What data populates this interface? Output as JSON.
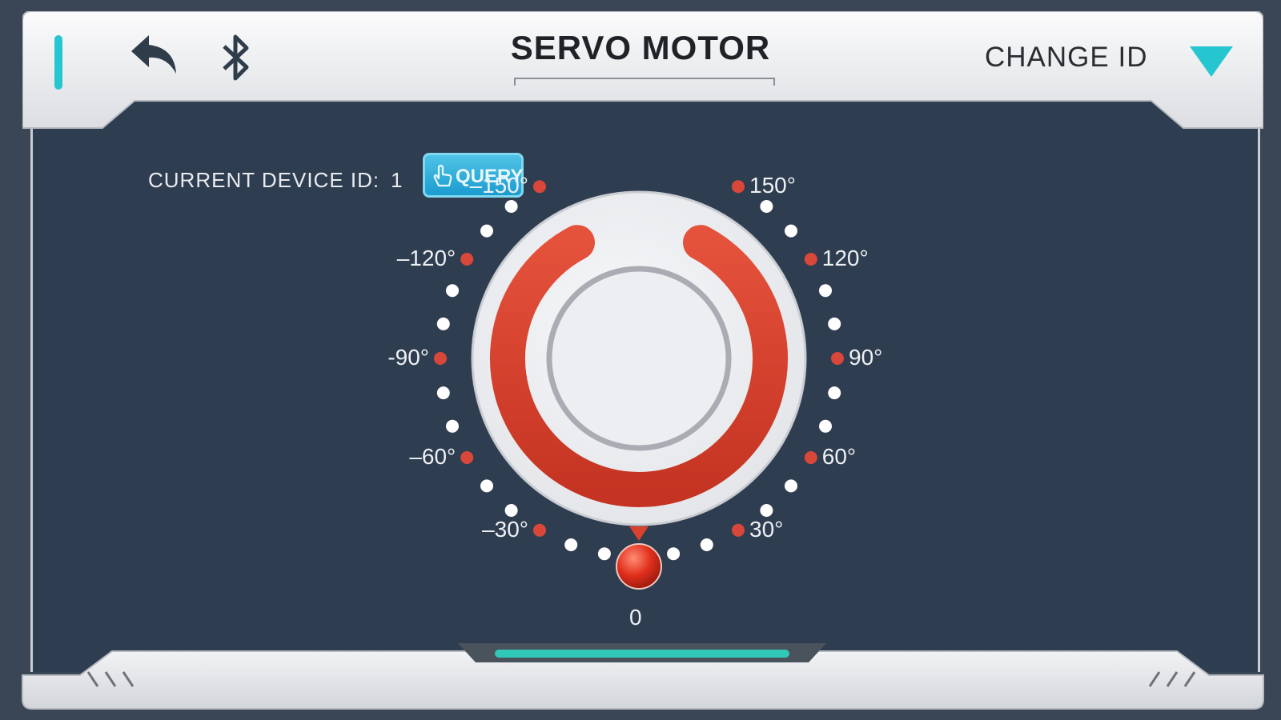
{
  "header": {
    "title": "SERVO MOTOR",
    "change_id_label": "CHANGE ID",
    "icons": [
      "accent-bar",
      "back-arrow-icon",
      "bluetooth-icon",
      "dropdown-triangle-icon"
    ]
  },
  "device": {
    "label": "CURRENT DEVICE ID:",
    "id_value": "1",
    "query_label": "QUERY"
  },
  "dial": {
    "current_angle": 0,
    "current_angle_label": "0",
    "labels": [
      {
        "angle": 150,
        "text": "150°"
      },
      {
        "angle": 120,
        "text": "120°"
      },
      {
        "angle": 90,
        "text": "90°"
      },
      {
        "angle": 60,
        "text": "60°"
      },
      {
        "angle": 30,
        "text": "30°"
      },
      {
        "angle": -30,
        "text": "–30°"
      },
      {
        "angle": -60,
        "text": "–60°"
      },
      {
        "angle": -90,
        "text": "-90°"
      },
      {
        "angle": -120,
        "text": "–120°"
      },
      {
        "angle": -150,
        "text": "–150°"
      }
    ],
    "colors": {
      "arc": "#d7412e",
      "major_dot": "#d9473a",
      "minor_dot": "#ffffff",
      "accent": "#26c6d0"
    }
  }
}
